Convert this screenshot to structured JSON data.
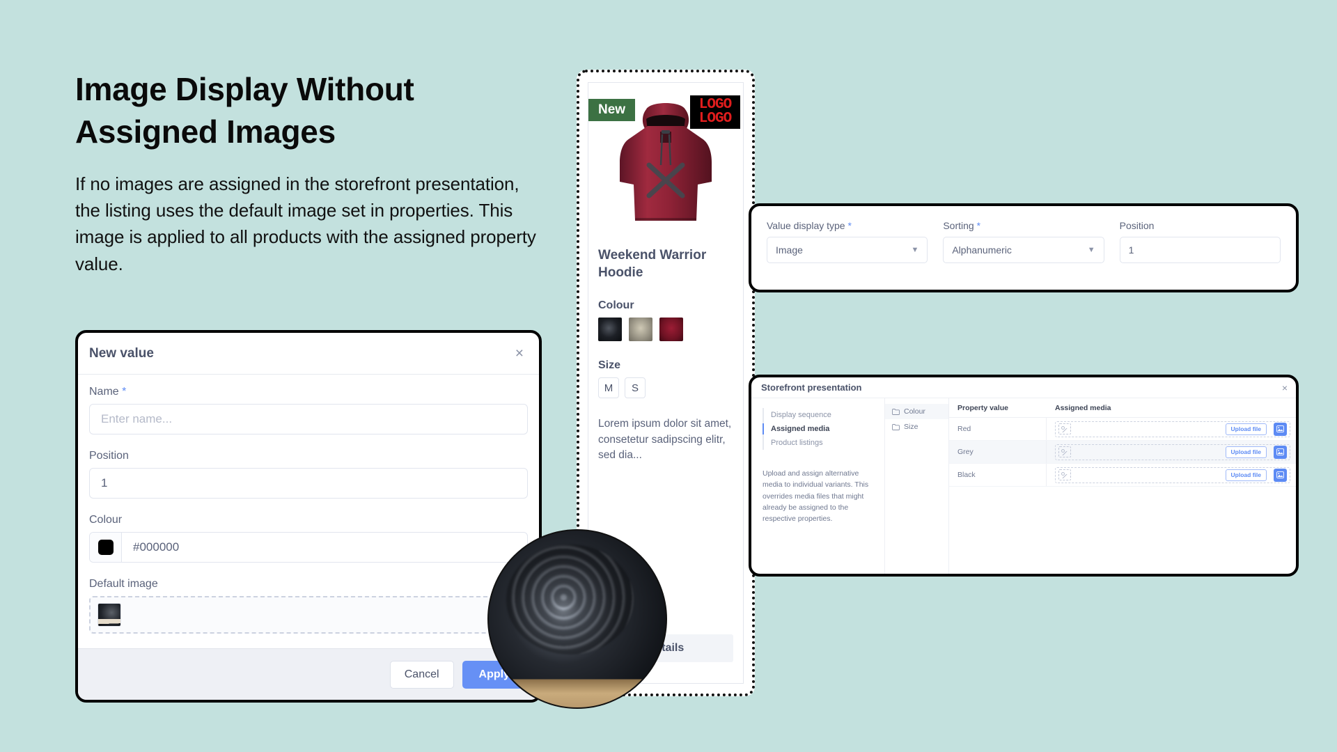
{
  "page": {
    "background_color": "#c3e1de",
    "headline": "Image Display Without Assigned Images",
    "subcopy": "If no images are assigned in the storefront presentation, the listing uses the default image set in properties. This image is applied to all products with the assigned property value."
  },
  "dialog": {
    "title": "New value",
    "close_icon": "close-icon",
    "fields": {
      "name_label": "Name",
      "name_required": "*",
      "name_placeholder": "Enter name...",
      "name_value": "",
      "position_label": "Position",
      "position_value": "1",
      "colour_label": "Colour",
      "colour_value": "#000000",
      "colour_swatch": "#000000",
      "default_image_label": "Default image"
    },
    "buttons": {
      "cancel": "Cancel",
      "apply": "Apply",
      "apply_color": "#6690f5"
    }
  },
  "product_card": {
    "badge": "New",
    "logo_line1": "LOGO",
    "logo_line2": "LOGO",
    "logo_color": "#e11d1d",
    "badge_color": "#3c7143",
    "title": "Weekend Warrior Hoodie",
    "colour_label": "Colour",
    "swatches": [
      {
        "name": "Black",
        "hex": "#14171c"
      },
      {
        "name": "Grey",
        "hex": "#9b9687"
      },
      {
        "name": "Red",
        "hex": "#6e1223"
      }
    ],
    "size_label": "Size",
    "sizes": [
      "M",
      "S"
    ],
    "description": "Lorem ipsum dolor sit amet, consetetur sadipscing elitr, sed dia...",
    "details_button": "Details"
  },
  "top_panel": {
    "value_display_type": {
      "label": "Value display type",
      "required": "*",
      "value": "Image"
    },
    "sorting": {
      "label": "Sorting",
      "required": "*",
      "value": "Alphanumeric"
    },
    "position": {
      "label": "Position",
      "value": "1"
    },
    "caret_icon": "chevron-down-icon"
  },
  "storefront_panel": {
    "title": "Storefront presentation",
    "close_icon": "close-icon",
    "nav_items": [
      {
        "label": "Display sequence",
        "active": false
      },
      {
        "label": "Assigned media",
        "active": true
      },
      {
        "label": "Product listings",
        "active": false
      }
    ],
    "description": "Upload and assign alternative media to individual variants. This overrides media files that might already be assigned to the respective properties.",
    "tree": [
      {
        "label": "Colour",
        "icon": "folder-icon",
        "selected": true
      },
      {
        "label": "Size",
        "icon": "folder-icon",
        "selected": false
      }
    ],
    "table": {
      "columns": [
        "Property value",
        "Assigned media"
      ],
      "rows": [
        {
          "property_value": "Red",
          "upload_label": "Upload file",
          "picker_icon": "image-picker-icon"
        },
        {
          "property_value": "Grey",
          "upload_label": "Upload file",
          "picker_icon": "image-picker-icon"
        },
        {
          "property_value": "Black",
          "upload_label": "Upload file",
          "picker_icon": "image-picker-icon"
        }
      ]
    }
  }
}
